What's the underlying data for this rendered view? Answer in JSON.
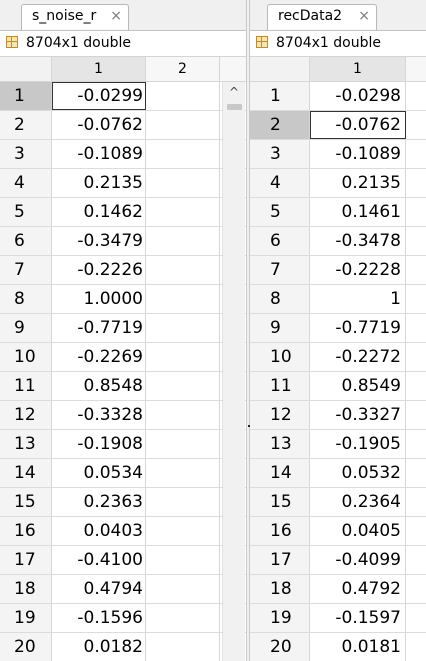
{
  "left": {
    "tab_label": "s_noise_r",
    "close_glyph": "×",
    "info": "8704x1 double",
    "col_headers": [
      "1",
      "2"
    ],
    "selected_row": 1,
    "rows": [
      {
        "n": "1",
        "v": "-0.0299"
      },
      {
        "n": "2",
        "v": "-0.0762"
      },
      {
        "n": "3",
        "v": "-0.1089"
      },
      {
        "n": "4",
        "v": "0.2135"
      },
      {
        "n": "5",
        "v": "0.1462"
      },
      {
        "n": "6",
        "v": "-0.3479"
      },
      {
        "n": "7",
        "v": "-0.2226"
      },
      {
        "n": "8",
        "v": "1.0000"
      },
      {
        "n": "9",
        "v": "-0.7719"
      },
      {
        "n": "10",
        "v": "-0.2269"
      },
      {
        "n": "11",
        "v": "0.8548"
      },
      {
        "n": "12",
        "v": "-0.3328"
      },
      {
        "n": "13",
        "v": "-0.1908"
      },
      {
        "n": "14",
        "v": "0.0534"
      },
      {
        "n": "15",
        "v": "0.2363"
      },
      {
        "n": "16",
        "v": "0.0403"
      },
      {
        "n": "17",
        "v": "-0.4100"
      },
      {
        "n": "18",
        "v": "0.4794"
      },
      {
        "n": "19",
        "v": "-0.1596"
      },
      {
        "n": "20",
        "v": "0.0182"
      }
    ]
  },
  "right": {
    "tab_label": "recData2",
    "close_glyph": "×",
    "info": "8704x1 double",
    "col_headers": [
      "1"
    ],
    "selected_row": 2,
    "rows": [
      {
        "n": "1",
        "v": "-0.0298"
      },
      {
        "n": "2",
        "v": "-0.0762"
      },
      {
        "n": "3",
        "v": "-0.1089"
      },
      {
        "n": "4",
        "v": "0.2135"
      },
      {
        "n": "5",
        "v": "0.1461"
      },
      {
        "n": "6",
        "v": "-0.3478"
      },
      {
        "n": "7",
        "v": "-0.2228"
      },
      {
        "n": "8",
        "v": "1"
      },
      {
        "n": "9",
        "v": "-0.7719"
      },
      {
        "n": "10",
        "v": "-0.2272"
      },
      {
        "n": "11",
        "v": "0.8549"
      },
      {
        "n": "12",
        "v": "-0.3327"
      },
      {
        "n": "13",
        "v": "-0.1905"
      },
      {
        "n": "14",
        "v": "0.0532"
      },
      {
        "n": "15",
        "v": "0.2364"
      },
      {
        "n": "16",
        "v": "0.0405"
      },
      {
        "n": "17",
        "v": "-0.4099"
      },
      {
        "n": "18",
        "v": "0.4792"
      },
      {
        "n": "19",
        "v": "-0.1597"
      },
      {
        "n": "20",
        "v": "0.0181"
      }
    ]
  },
  "scroll_up_glyph": "^"
}
